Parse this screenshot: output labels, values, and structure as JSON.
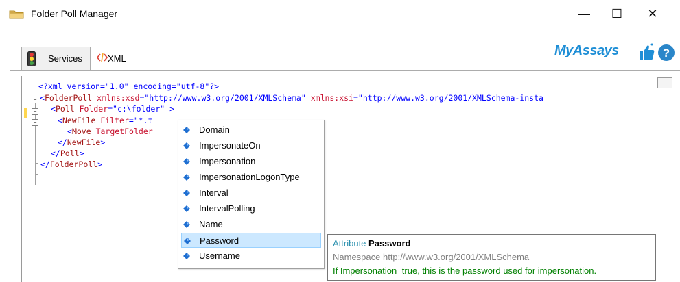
{
  "window": {
    "title": "Folder Poll Manager",
    "controls": {
      "minimize": "—",
      "maximize": "☐",
      "close": "✕"
    }
  },
  "tabs": [
    {
      "label": "Services",
      "icon": "traffic-light-icon",
      "active": false
    },
    {
      "label": "XML",
      "icon": "xml-code-icon",
      "active": true
    }
  ],
  "branding": {
    "logo_text": "MyAssays",
    "logo_color": "#1e8ed6",
    "help_icon": "help-icon"
  },
  "editor": {
    "lines": [
      {
        "segments": [
          {
            "t": "<?xml version=\"1.0\" encoding=\"utf-8\"?>",
            "c": "blue"
          }
        ]
      },
      {
        "segments": [
          {
            "t": "<",
            "c": "blue"
          },
          {
            "t": "FolderPoll",
            "c": "maroon"
          },
          {
            "t": " ",
            "c": "blue"
          },
          {
            "t": "xmlns:xsd",
            "c": "red"
          },
          {
            "t": "=\"http://www.w3.org/2001/XMLSchema\" ",
            "c": "blue"
          },
          {
            "t": "xmlns:xsi",
            "c": "red"
          },
          {
            "t": "=\"http://www.w3.org/2001/XMLSchema-insta",
            "c": "blue"
          }
        ]
      },
      {
        "segments": [
          {
            "t": "<",
            "c": "blue"
          },
          {
            "t": "Poll",
            "c": "maroon"
          },
          {
            "t": " ",
            "c": "blue"
          },
          {
            "t": "Folder",
            "c": "red"
          },
          {
            "t": "=\"c:\\folder\" ",
            "c": "blue"
          },
          {
            "t": ">",
            "c": "blue"
          }
        ]
      },
      {
        "segments": [
          {
            "t": "<",
            "c": "blue"
          },
          {
            "t": "NewFile",
            "c": "maroon"
          },
          {
            "t": " ",
            "c": "blue"
          },
          {
            "t": "Filter",
            "c": "red"
          },
          {
            "t": "=\"*.t",
            "c": "blue"
          }
        ]
      },
      {
        "segments": [
          {
            "t": "<",
            "c": "blue"
          },
          {
            "t": "Move",
            "c": "maroon"
          },
          {
            "t": " ",
            "c": "blue"
          },
          {
            "t": "TargetFolder",
            "c": "red"
          }
        ]
      },
      {
        "segments": [
          {
            "t": "</",
            "c": "blue"
          },
          {
            "t": "NewFile",
            "c": "maroon"
          },
          {
            "t": ">",
            "c": "blue"
          }
        ]
      },
      {
        "segments": [
          {
            "t": "</",
            "c": "blue"
          },
          {
            "t": "Poll",
            "c": "maroon"
          },
          {
            "t": ">",
            "c": "blue"
          }
        ]
      },
      {
        "segments": [
          {
            "t": "</",
            "c": "blue"
          },
          {
            "t": "FolderPoll",
            "c": "maroon"
          },
          {
            "t": ">",
            "c": "blue"
          }
        ]
      }
    ]
  },
  "completion": {
    "items": [
      {
        "label": "Domain",
        "icon": "attribute-icon",
        "selected": false
      },
      {
        "label": "ImpersonateOn",
        "icon": "attribute-icon",
        "selected": false
      },
      {
        "label": "Impersonation",
        "icon": "attribute-icon",
        "selected": false
      },
      {
        "label": "ImpersonationLogonType",
        "icon": "attribute-icon",
        "selected": false
      },
      {
        "label": "Interval",
        "icon": "attribute-icon",
        "selected": false
      },
      {
        "label": "IntervalPolling",
        "icon": "attribute-icon",
        "selected": false
      },
      {
        "label": "Name",
        "icon": "attribute-icon",
        "selected": false
      },
      {
        "label": "Password",
        "icon": "attribute-icon",
        "selected": true
      },
      {
        "label": "Username",
        "icon": "attribute-icon",
        "selected": false
      }
    ]
  },
  "tooltip": {
    "kind": "Attribute",
    "name": "Password",
    "namespace": "Namespace http://www.w3.org/2001/XMLSchema",
    "description": "If Impersonation=true, this is the password used for impersonation."
  }
}
